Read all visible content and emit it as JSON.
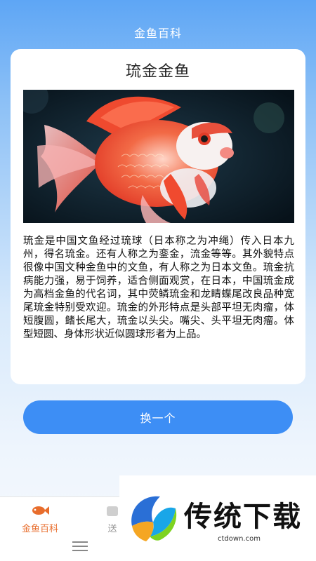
{
  "header": {
    "title": "金鱼百科"
  },
  "card": {
    "title": "琉金金鱼",
    "image_alt": "琉金金鱼 photo",
    "description": "琉金是中国文鱼经过琉球（日本称之为冲绳）传入日本九州，得名琉金。还有人称之为銮金，流金等等。其外貌特点很像中国文种金鱼中的文鱼，有人称之为日本文鱼。琉金抗病能力强，易于饲养，适合侧面观赏，在日本，中国琉金成为高档金鱼的代名词，其中荧鳞琉金和龙睛蝶尾改良品种宽尾琉金特别受欢迎。琉金的外形特点是头部平坦无肉瘤，体短腹圆，鳍长尾大，琉金以头尖。嘴尖、头平坦无肉瘤。体型短圆、身体形状近似圆球形者为上品。"
  },
  "actions": {
    "switch_label": "换一个"
  },
  "tabbar": {
    "items": [
      {
        "label": "金鱼百科",
        "icon": "fish-icon",
        "active": true
      },
      {
        "label": "送",
        "icon": "gift-icon",
        "active": false
      }
    ]
  },
  "watermark": {
    "text": "传统下载",
    "url": "ctdown.com"
  },
  "colors": {
    "accent": "#3d8ef5",
    "active_tab": "#e86d2c"
  }
}
